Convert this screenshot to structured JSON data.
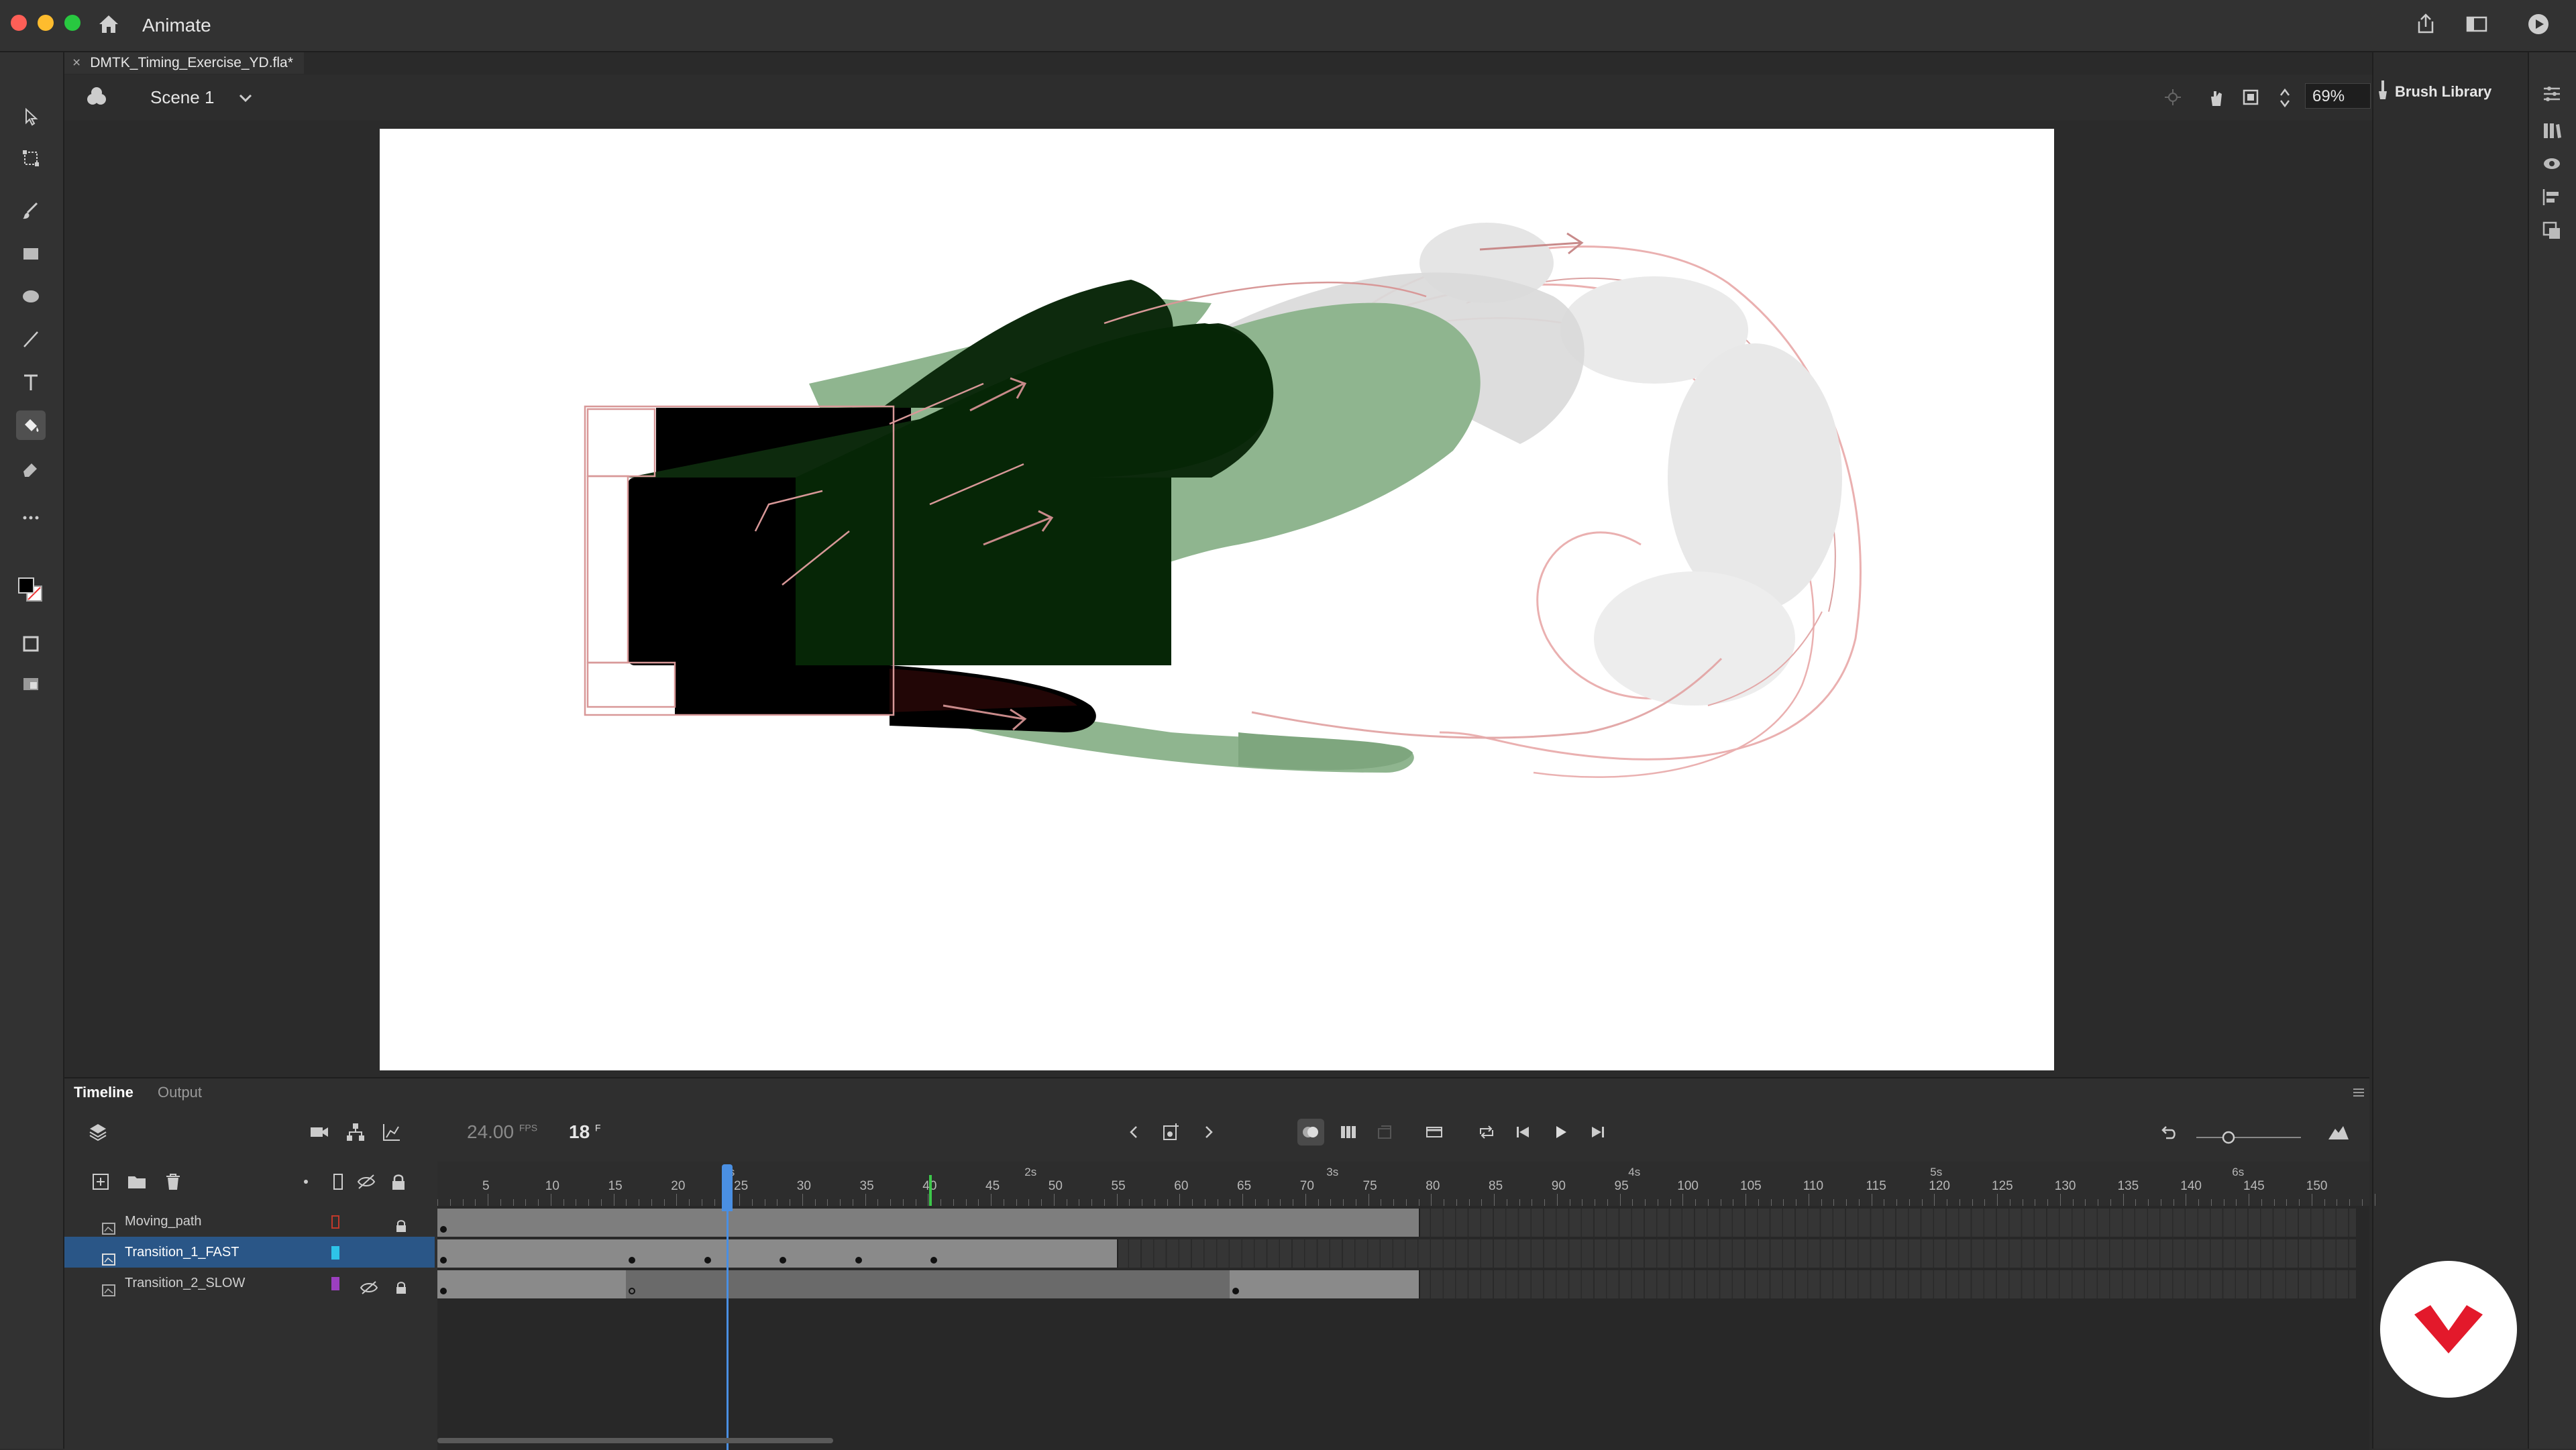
{
  "app": {
    "name": "Animate"
  },
  "document": {
    "tab_title": "DMTK_Timing_Exercise_YD.fla*",
    "close_glyph": "×"
  },
  "scene": {
    "name": "Scene 1",
    "zoom": "69%"
  },
  "right_panel": {
    "title": "Brush Library"
  },
  "timeline": {
    "tabs": [
      "Timeline",
      "Output"
    ],
    "fps_value": "24.00",
    "fps_unit": "FPS",
    "current_frame": "18",
    "frame_unit": "F",
    "seconds_labels": [
      "1s",
      "2s",
      "3s",
      "4s",
      "5s",
      "6s"
    ],
    "ruler_ticks": [
      "5",
      "10",
      "15",
      "20",
      "25",
      "30",
      "35",
      "40",
      "45",
      "50",
      "55",
      "60",
      "65",
      "70",
      "75",
      "80",
      "85",
      "90",
      "95",
      "100",
      "105",
      "110",
      "115",
      "120",
      "125",
      "130",
      "135",
      "140",
      "145",
      "150"
    ],
    "layers": [
      {
        "name": "Moving_path",
        "color": "#c0392b",
        "selected": false
      },
      {
        "name": "Transition_1_FAST",
        "color": "#2ec4e8",
        "selected": true
      },
      {
        "name": "Transition_2_SLOW",
        "color": "#9b3fc0",
        "selected": false
      }
    ]
  },
  "colors": {
    "accent": "#4a8fe2",
    "stage": "#ffffff",
    "logo": "#e3192b"
  }
}
